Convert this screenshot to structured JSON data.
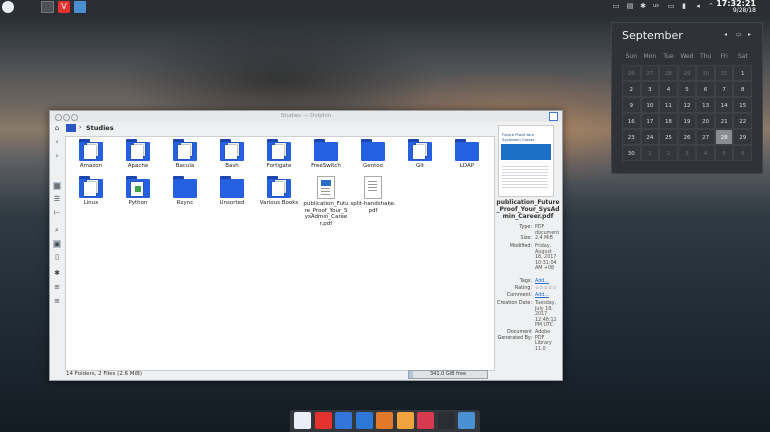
{
  "top_panel": {
    "tasks": [
      "plasma-icon",
      "window-thumb",
      "vivaldi-icon",
      "dolphin-icon"
    ],
    "tray": {
      "keyboard_layout": "us"
    },
    "clock": {
      "time": "17:32:21",
      "date": "9/28/18"
    }
  },
  "calendar": {
    "month": "September",
    "weekdays": [
      "Sun",
      "Mon",
      "Tue",
      "Wed",
      "Thu",
      "Fri",
      "Sat"
    ],
    "weeks": [
      [
        "26",
        "27",
        "28",
        "29",
        "30",
        "31",
        "1"
      ],
      [
        "2",
        "3",
        "4",
        "5",
        "6",
        "7",
        "8"
      ],
      [
        "9",
        "10",
        "11",
        "12",
        "13",
        "14",
        "15"
      ],
      [
        "16",
        "17",
        "18",
        "19",
        "20",
        "21",
        "22"
      ],
      [
        "23",
        "24",
        "25",
        "26",
        "27",
        "28",
        "29"
      ],
      [
        "30",
        "1",
        "2",
        "3",
        "4",
        "5",
        "6"
      ]
    ],
    "today": "28"
  },
  "window": {
    "title": "Studies — Dolphin",
    "breadcrumb": "Studies",
    "items": [
      {
        "label": "Amazon",
        "kind": "folder-doc"
      },
      {
        "label": "Apache",
        "kind": "folder-doc"
      },
      {
        "label": "Bacula",
        "kind": "folder-doc"
      },
      {
        "label": "Bash",
        "kind": "folder-doc"
      },
      {
        "label": "Fortigate",
        "kind": "folder-doc"
      },
      {
        "label": "FreeSwitch",
        "kind": "folder"
      },
      {
        "label": "Gentoo",
        "kind": "folder"
      },
      {
        "label": "Git",
        "kind": "folder-doc"
      },
      {
        "label": "LDAP",
        "kind": "folder"
      },
      {
        "label": "Linux",
        "kind": "folder-doc"
      },
      {
        "label": "Python",
        "kind": "folder-img"
      },
      {
        "label": "Rsync",
        "kind": "folder"
      },
      {
        "label": "Unsorted",
        "kind": "folder"
      },
      {
        "label": "Various Books",
        "kind": "folder-doc"
      },
      {
        "label": "publication_Future_Proof_Your_SysAdmin_Career.pdf",
        "kind": "pdf"
      },
      {
        "label": "split-handshake.pdf",
        "kind": "doc"
      }
    ],
    "status": "14 Folders, 2 Files (2.6 MiB)",
    "free_space": "341.0 GiB free",
    "free_used_fraction": 0.05,
    "info": {
      "preview_title": "Future Proof Your SysAdmin Career",
      "file_name": "publication_Future_Proof_Your_SysAdmin_Career.pdf",
      "fields": [
        {
          "k": "Type:",
          "v": "PDF document"
        },
        {
          "k": "Size:",
          "v": "2.4 MiB"
        },
        {
          "k": "Modified:",
          "v": "Friday, August 18, 2017 10:31:04 AM +08"
        },
        {
          "k": "Tags:",
          "v": "Add...",
          "link": true
        },
        {
          "k": "Rating:",
          "v": "☆☆☆☆☆"
        },
        {
          "k": "Comment:",
          "v": "Add...",
          "link": true
        },
        {
          "k": "Creation Date:",
          "v": "Tuesday, July 18, 2017 12:48:12 PM UTC"
        },
        {
          "k": "Document Generated By:",
          "v": "Adobe PDF Library 11.0"
        }
      ]
    }
  },
  "dock": {
    "apps": [
      {
        "name": "plasma-icon",
        "color": "#e9eef7"
      },
      {
        "name": "vivaldi-icon",
        "color": "#e5322e"
      },
      {
        "name": "files-icon",
        "color": "#3474d8"
      },
      {
        "name": "globe-icon",
        "color": "#2d77d6"
      },
      {
        "name": "firefox-icon",
        "color": "#e0792a"
      },
      {
        "name": "notes-icon",
        "color": "#f0a23c"
      },
      {
        "name": "gear-app-icon",
        "color": "#d73a4f"
      },
      {
        "name": "terminal-icon",
        "color": "#2a2d31"
      },
      {
        "name": "dolphin-icon",
        "color": "#4a8fd2"
      }
    ]
  }
}
